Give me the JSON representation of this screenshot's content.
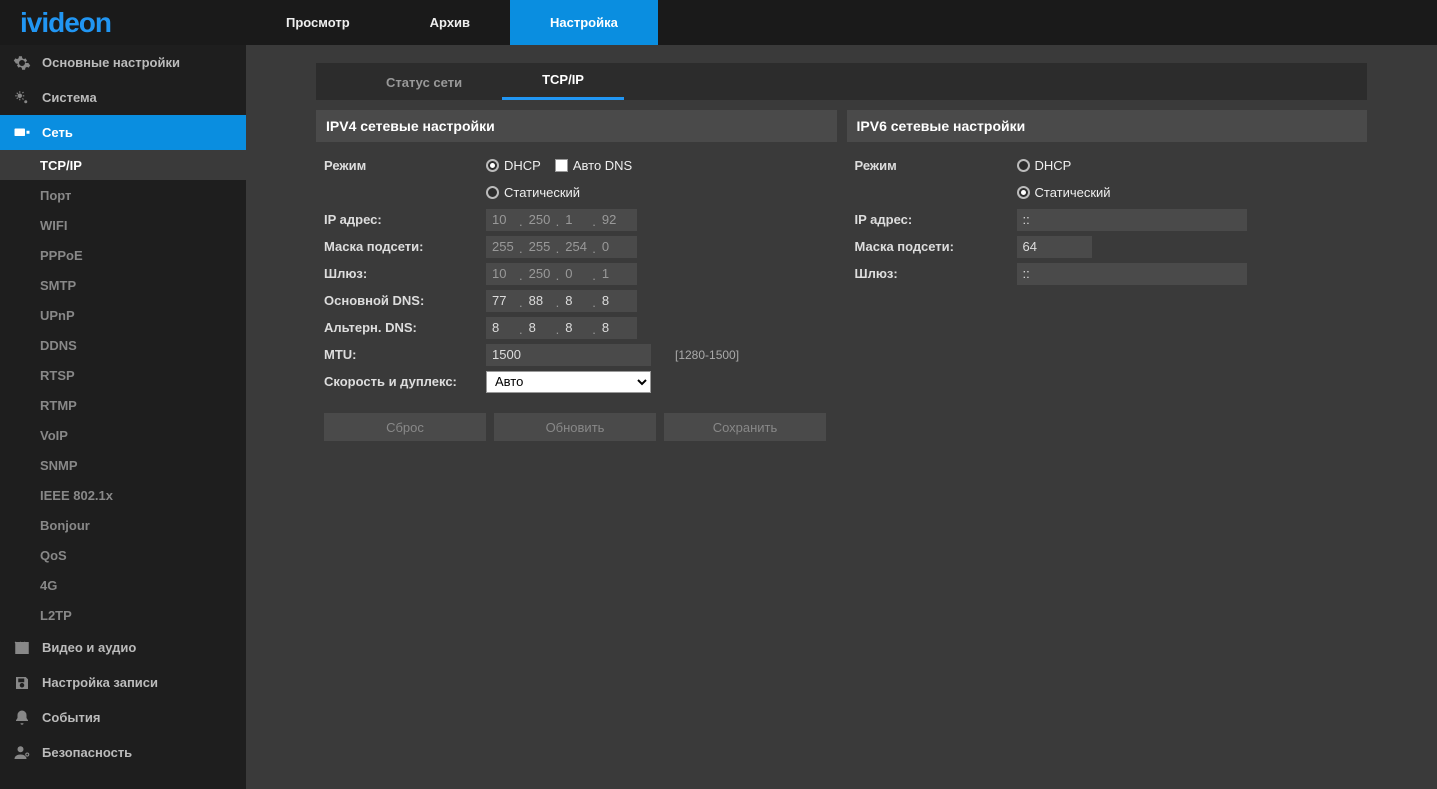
{
  "brand": "ivideon",
  "topTabs": {
    "view": "Просмотр",
    "archive": "Архив",
    "setup": "Настройка"
  },
  "sidebar": {
    "main": "Основные настройки",
    "system": "Система",
    "network": "Сеть",
    "networkSub": {
      "tcpip": "TCP/IP",
      "port": "Порт",
      "wifi": "WIFI",
      "pppoe": "PPPoE",
      "smtp": "SMTP",
      "upnp": "UPnP",
      "ddns": "DDNS",
      "rtsp": "RTSP",
      "rtmp": "RTMP",
      "voip": "VoIP",
      "snmp": "SNMP",
      "ieee": "IEEE 802.1x",
      "bonjour": "Bonjour",
      "qos": "QoS",
      "g4": "4G",
      "l2tp": "L2TP"
    },
    "videoaudio": "Видео и аудио",
    "record": "Настройка записи",
    "events": "События",
    "security": "Безопасность"
  },
  "tabs": {
    "status": "Статус сети",
    "tcpip": "TCP/IP"
  },
  "ipv4": {
    "title": "IPV4 сетевые настройки",
    "modeLabel": "Режим",
    "dhcp": "DHCP",
    "autodns": "Авто DNS",
    "static": "Статический",
    "ipLabel": "IP адрес:",
    "ip": [
      "10",
      "250",
      "1",
      "92"
    ],
    "maskLabel": "Маска подсети:",
    "mask": [
      "255",
      "255",
      "254",
      "0"
    ],
    "gwLabel": "Шлюз:",
    "gw": [
      "10",
      "250",
      "0",
      "1"
    ],
    "dns1Label": "Основной DNS:",
    "dns1": [
      "77",
      "88",
      "8",
      "8"
    ],
    "dns2Label": "Альтерн. DNS:",
    "dns2": [
      "8",
      "8",
      "8",
      "8"
    ],
    "mtuLabel": "MTU:",
    "mtu": "1500",
    "mtuHint": "[1280-1500]",
    "speedLabel": "Скорость и дуплекс:",
    "speed": "Авто"
  },
  "ipv6": {
    "title": "IPV6 сетевые настройки",
    "modeLabel": "Режим",
    "dhcp": "DHCP",
    "static": "Статический",
    "ipLabel": "IP адрес:",
    "ip": "::",
    "maskLabel": "Маска подсети:",
    "mask": "64",
    "gwLabel": "Шлюз:",
    "gw": "::"
  },
  "buttons": {
    "reset": "Сброс",
    "refresh": "Обновить",
    "save": "Сохранить"
  }
}
